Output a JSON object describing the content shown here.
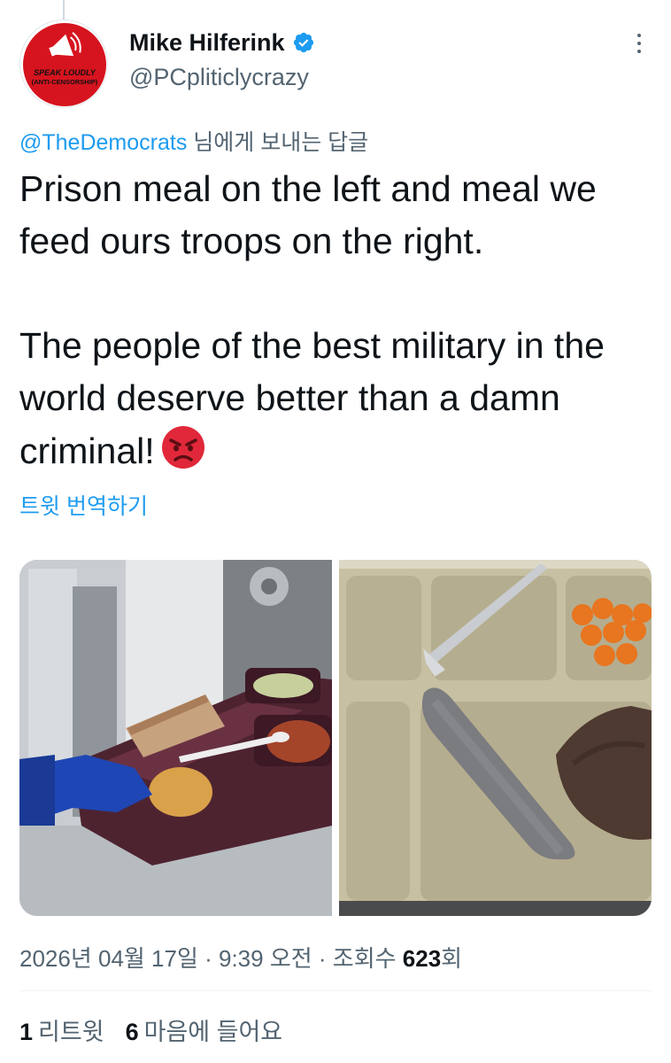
{
  "author": {
    "display_name": "Mike Hilferink",
    "handle": "@PCpliticlycrazy",
    "avatar_text_line1": "SPEAK LOUDLY",
    "avatar_text_line2": "(ANTI-CENSORSHIP)",
    "verified_icon": "verified-badge-icon",
    "avatar_colors": {
      "circle": "#d6141f",
      "text": "#111111"
    }
  },
  "reply_to": {
    "handle": "@TheDemocrats",
    "suffix": " 님에게 보내는 답글"
  },
  "tweet": {
    "text": "Prison meal on the left and meal we feed ours troops on the right.\n\nThe people of the best military in the world deserve better than a damn criminal!",
    "emoji_icon": "angry-face-icon"
  },
  "translate_label": "트윗 번역하기",
  "media": [
    {
      "icon": "prison-meal-photo"
    },
    {
      "icon": "military-meal-photo"
    }
  ],
  "meta": {
    "date": "2026년 04월 17일",
    "time": "9:39 오전",
    "views_label": "조회수",
    "views_count": "623",
    "views_suffix": "회",
    "separator": " · "
  },
  "stats": {
    "retweets_count": "1",
    "retweets_label": "리트윗",
    "likes_count": "6",
    "likes_label": "마음에 들어요"
  },
  "colors": {
    "accent": "#1d9bf0",
    "secondary_text": "#536471",
    "primary_text": "#0f1419"
  }
}
